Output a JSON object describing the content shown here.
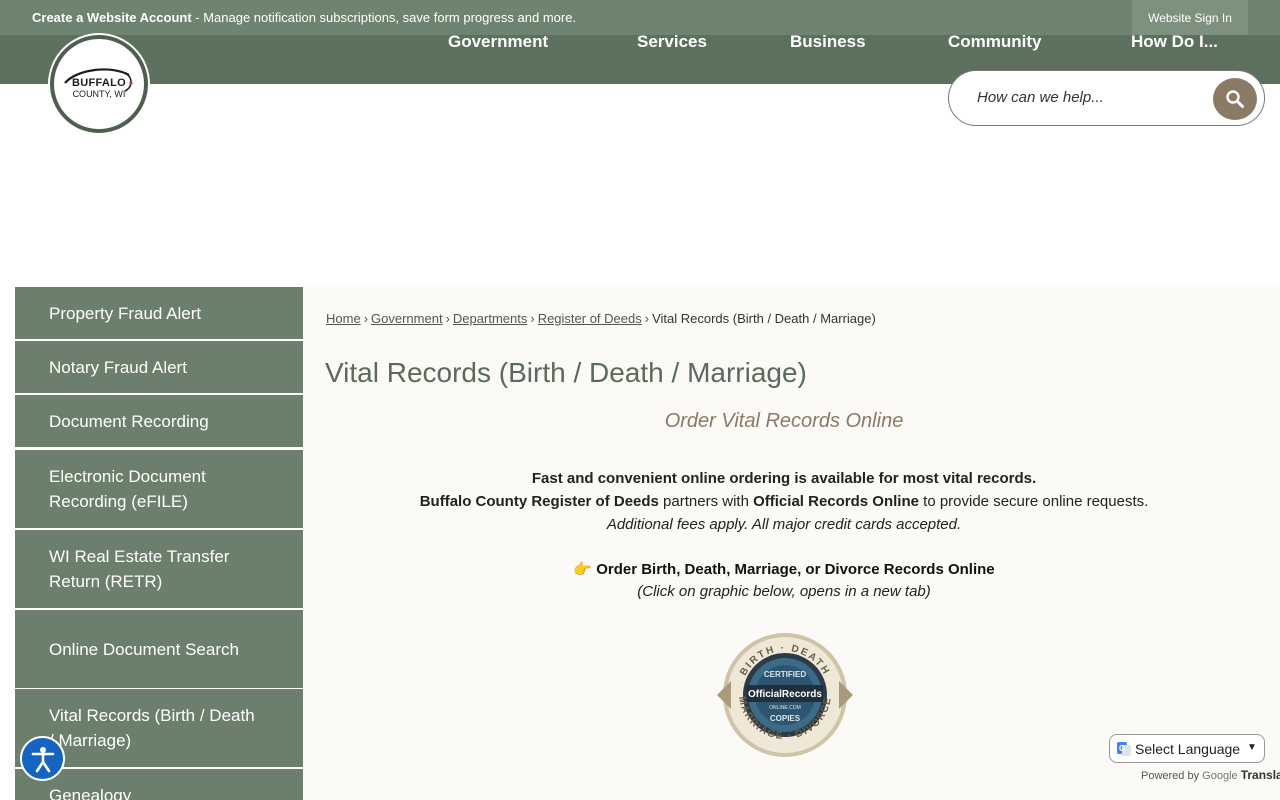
{
  "topbar": {
    "create_bold": "Create a Website Account",
    "create_rest": " - Manage notification subscriptions, save form progress and more.",
    "signin": "Website Sign In"
  },
  "nav": {
    "items": [
      "Government",
      "Services",
      "Business",
      "Community",
      "How Do I..."
    ]
  },
  "logo": {
    "line1": "BUFFALO",
    "line2": "COUNTY, WI"
  },
  "search": {
    "placeholder": "How can we help..."
  },
  "sidebar": {
    "items": [
      "Property Fraud Alert",
      "Notary Fraud Alert",
      "Document Recording",
      "Electronic Document Recording (eFILE)",
      "WI Real Estate Transfer Return (RETR)",
      "Online Document Search",
      "Vital Records (Birth / Death / Marriage)",
      "Genealogy"
    ]
  },
  "breadcrumb": {
    "home": "Home",
    "government": "Government",
    "departments": "Departments",
    "register": "Register of Deeds",
    "current": "Vital Records (Birth / Death / Marriage)",
    "separator": "›"
  },
  "content": {
    "title": "Vital Records (Birth / Death / Marriage)",
    "subtitle": "Order Vital Records Online",
    "line1": "Fast and convenient online ordering is available for most vital records.",
    "line2_a": "Buffalo County Register of Deeds",
    "line2_b": " partners with ",
    "line2_c": "Official Records Online",
    "line2_d": " to provide secure online requests.",
    "line3": "Additional fees apply. All major credit cards accepted.",
    "order_link": "Order Birth, Death, Marriage, or Divorce Records Online",
    "order_emoji": "👉",
    "click_note": "(Click on graphic below, opens in a new tab)"
  },
  "seal": {
    "top": "BIRTH · DEATH",
    "bottom": "MARRIAGE · DIVORCE",
    "certified": "CERTIFIED",
    "brand": "OfficialRecords",
    "brand_sub": "ONLINE.COM",
    "copies": "COPIES"
  },
  "translate": {
    "select_label": "Select Language",
    "powered_by": "Powered by",
    "google": "Google",
    "translate": "Translate"
  },
  "colors": {
    "topbar": "#6f8470",
    "navbar": "#5c705d",
    "sidebar": "#6b7f6c",
    "title": "#5a6b5b",
    "accent_tan": "#8a7a66",
    "content_bg": "#fbfaf6"
  }
}
